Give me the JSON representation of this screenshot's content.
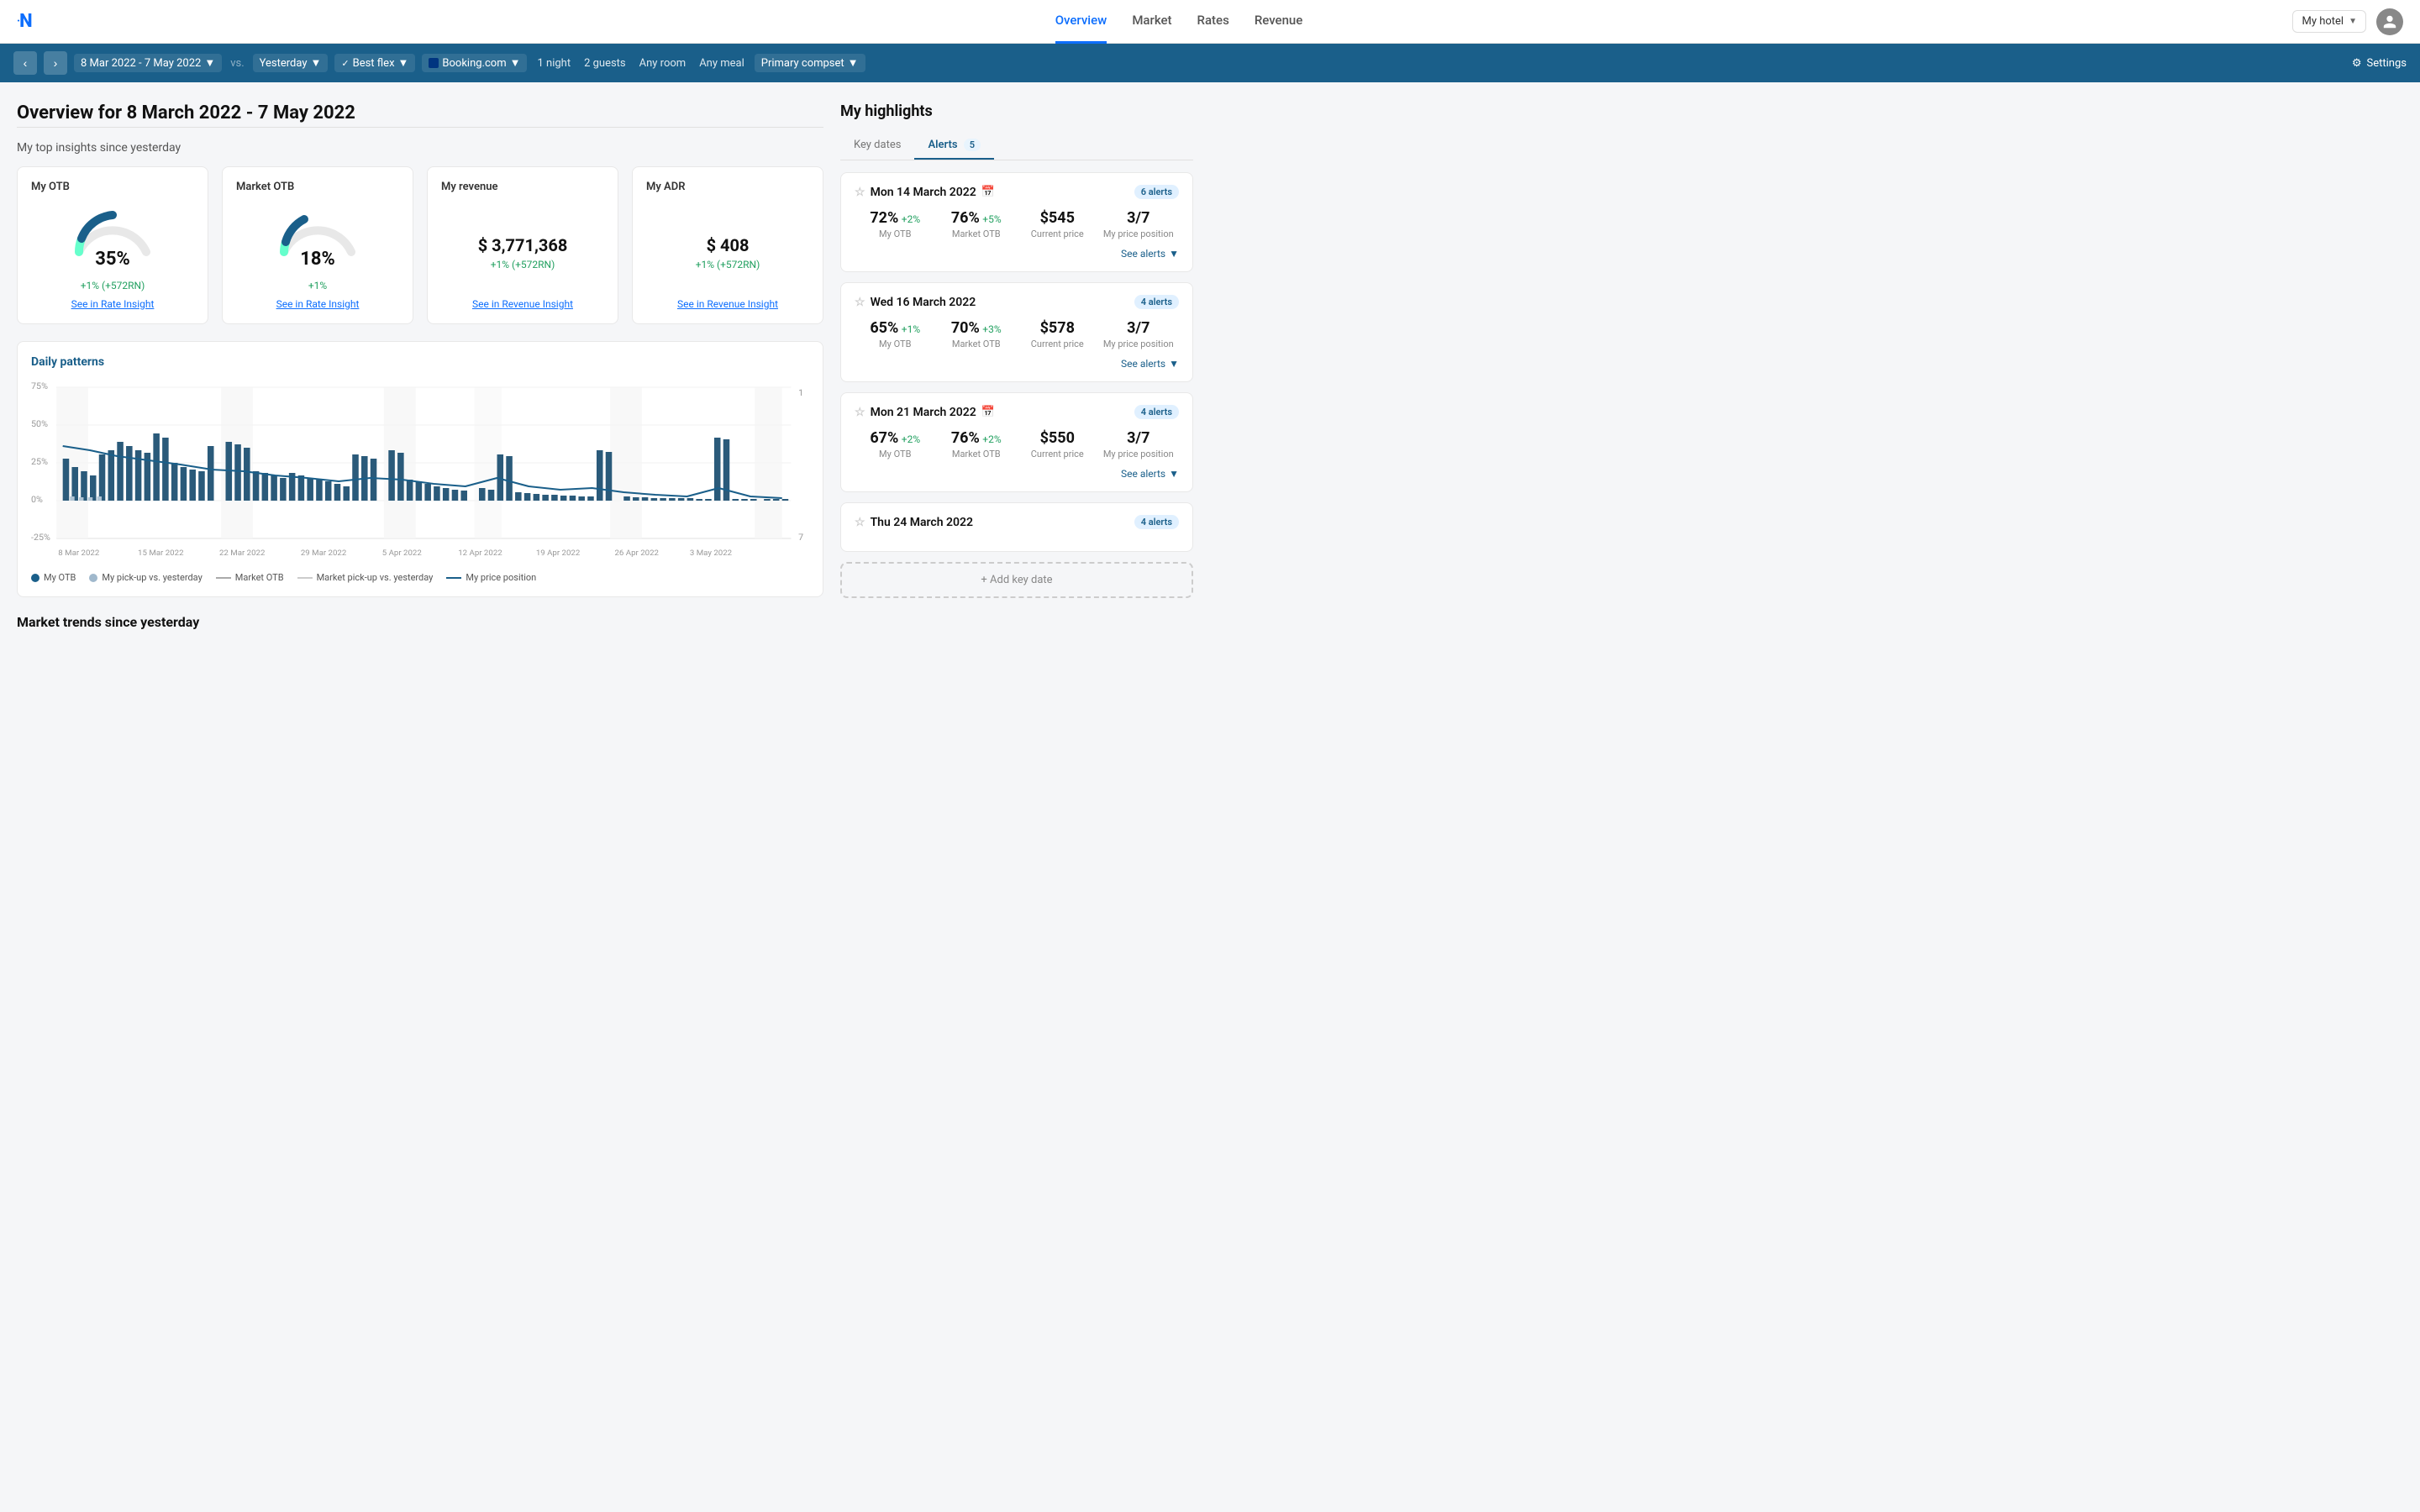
{
  "app": {
    "logo_letter": "N",
    "hotel_label": "My hotel"
  },
  "nav": {
    "links": [
      {
        "id": "overview",
        "label": "Overview",
        "active": true
      },
      {
        "id": "market",
        "label": "Market",
        "active": false
      },
      {
        "id": "rates",
        "label": "Rates",
        "active": false
      },
      {
        "id": "revenue",
        "label": "Revenue",
        "active": false
      }
    ]
  },
  "filter_bar": {
    "date_range": "8 Mar 2022 - 7 May 2022",
    "vs_label": "vs.",
    "vs_value": "Yesterday",
    "flex_label": "Best flex",
    "channel_label": "Booking.com",
    "nights": "1 night",
    "guests": "2 guests",
    "room": "Any room",
    "meal": "Any meal",
    "compset": "Primary compset",
    "settings_label": "Settings"
  },
  "page": {
    "title": "Overview for 8 March 2022 - 7 May 2022",
    "insights_subtitle": "My top insights since yesterday"
  },
  "insight_cards": [
    {
      "id": "my-otb",
      "title": "My OTB",
      "value": "35%",
      "change": "+1% (+572RN)",
      "link": "See in Rate Insight",
      "type": "gauge",
      "gauge_pct": 35,
      "gauge_color": "#1a5f8a"
    },
    {
      "id": "market-otb",
      "title": "Market OTB",
      "value": "18%",
      "change": "+1%",
      "link": "See in Rate Insight",
      "type": "gauge",
      "gauge_pct": 18,
      "gauge_color": "#1a5f8a"
    },
    {
      "id": "my-revenue",
      "title": "My revenue",
      "value": "$ 3,771,368",
      "change": "+1% (+572RN)",
      "link": "See in Revenue Insight",
      "type": "number"
    },
    {
      "id": "my-adr",
      "title": "My ADR",
      "value": "$ 408",
      "change": "+1% (+572RN)",
      "link": "See in Revenue Insight",
      "type": "number"
    }
  ],
  "chart": {
    "title": "Daily patterns",
    "y_labels": [
      "75%",
      "50%",
      "25%",
      "0%",
      "-25%"
    ],
    "x_labels": [
      "8 Mar 2022",
      "15 Mar 2022",
      "22 Mar 2022",
      "29 Mar 2022",
      "5 Apr 2022",
      "12 Apr 2022",
      "19 Apr 2022",
      "26 Apr 2022",
      "3 May 2022"
    ],
    "right_labels": [
      "1",
      "7"
    ],
    "legend": [
      {
        "id": "my-otb",
        "label": "My OTB",
        "type": "dot",
        "color": "#1a5f8a"
      },
      {
        "id": "my-pickup",
        "label": "My pick-up vs. yesterday",
        "type": "dot",
        "color": "#a0b8cc"
      },
      {
        "id": "market-otb-legend",
        "label": "Market OTB",
        "type": "dash",
        "color": "#aaa"
      },
      {
        "id": "market-pickup",
        "label": "Market pick-up vs. yesterday",
        "type": "dash",
        "color": "#ccc"
      },
      {
        "id": "price-position",
        "label": "My price position",
        "type": "line",
        "color": "#1a5f8a"
      }
    ]
  },
  "highlights": {
    "title": "My highlights",
    "tabs": [
      {
        "id": "key-dates",
        "label": "Key dates",
        "active": false,
        "badge": null
      },
      {
        "id": "alerts",
        "label": "Alerts",
        "active": true,
        "badge": "5"
      }
    ],
    "alerts": [
      {
        "date": "Mon 14 March 2022",
        "has_calendar": true,
        "badge": "6 alerts",
        "metrics": [
          {
            "value": "72%",
            "change": "+2%",
            "label": "My OTB"
          },
          {
            "value": "76%",
            "change": "+5%",
            "label": "Market OTB"
          },
          {
            "value": "$545",
            "change": "",
            "label": "Current price"
          },
          {
            "value": "3/7",
            "change": "",
            "label": "My price position"
          }
        ],
        "see_alerts": "See alerts"
      },
      {
        "date": "Wed 16 March 2022",
        "has_calendar": false,
        "badge": "4 alerts",
        "metrics": [
          {
            "value": "65%",
            "change": "+1%",
            "label": "My OTB"
          },
          {
            "value": "70%",
            "change": "+3%",
            "label": "Market OTB"
          },
          {
            "value": "$578",
            "change": "",
            "label": "Current price"
          },
          {
            "value": "3/7",
            "change": "",
            "label": "My price position"
          }
        ],
        "see_alerts": "See alerts"
      },
      {
        "date": "Mon 21 March 2022",
        "has_calendar": true,
        "badge": "4 alerts",
        "metrics": [
          {
            "value": "67%",
            "change": "+2%",
            "label": "My OTB"
          },
          {
            "value": "76%",
            "change": "+2%",
            "label": "Market OTB"
          },
          {
            "value": "$550",
            "change": "",
            "label": "Current price"
          },
          {
            "value": "3/7",
            "change": "",
            "label": "My price position"
          }
        ],
        "see_alerts": "See alerts"
      },
      {
        "date": "Thu 24 March 2022",
        "has_calendar": false,
        "badge": "4 alerts",
        "metrics": [],
        "see_alerts": ""
      }
    ],
    "add_key_date": "+ Add key date"
  },
  "market_trends": {
    "title": "Market trends since yesterday"
  }
}
